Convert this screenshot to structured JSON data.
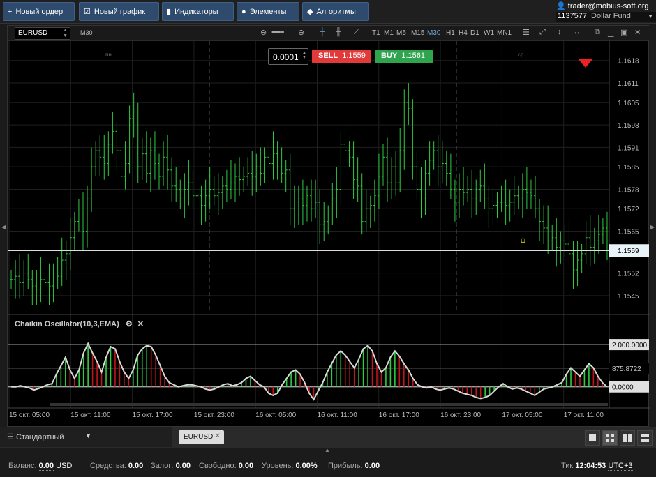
{
  "toolbar": {
    "new_order": "Новый ордер",
    "new_chart": "Новый график",
    "indicators": "Индикаторы",
    "elements": "Элементы",
    "algorithms": "Алгоритмы"
  },
  "account": {
    "user": "trader@mobius-soft.org",
    "id": "1137577",
    "fund": "Dollar Fund"
  },
  "chart": {
    "symbol": "EURUSD",
    "timeframe": "M30",
    "timeframes": [
      "T1",
      "M1",
      "M5",
      "M15",
      "M30",
      "H1",
      "H4",
      "D1",
      "W1",
      "MN1"
    ],
    "active_timeframe": "M30",
    "lot": "0.0001",
    "sell_label": "SELL",
    "sell_price": "1.1559",
    "buy_label": "BUY",
    "buy_price": "1.1561",
    "day_labels": [
      "пн",
      "ср"
    ],
    "current_price": "1.1559",
    "indicator_title": "Chaikin Oscillator(10,3,EMA)"
  },
  "chart_data": [
    {
      "type": "candlestick",
      "symbol": "EURUSD",
      "yticks": [
        "1.1618",
        "1.1611",
        "1.1605",
        "1.1598",
        "1.1591",
        "1.1585",
        "1.1578",
        "1.1572",
        "1.1565",
        "1.1559",
        "1.1552",
        "1.1545"
      ],
      "xticks": [
        "15 окт. 05:00",
        "15 окт. 11:00",
        "15 окт. 17:00",
        "15 окт. 23:00",
        "16 окт. 05:00",
        "16 окт. 11:00",
        "16 окт. 17:00",
        "16 окт. 23:00",
        "17 окт. 05:00",
        "17 окт. 11:00"
      ],
      "ylim": [
        1.154,
        1.1624
      ],
      "close": [
        1.155,
        1.1551,
        1.1549,
        1.1552,
        1.155,
        1.1548,
        1.1547,
        1.155,
        1.1549,
        1.1548,
        1.1552,
        1.1551,
        1.1556,
        1.1558,
        1.1563,
        1.1568,
        1.157,
        1.1565,
        1.1575,
        1.1585,
        1.159,
        1.1588,
        1.1586,
        1.1592,
        1.1596,
        1.159,
        1.1582,
        1.1586,
        1.16,
        1.1602,
        1.1585,
        1.1589,
        1.1583,
        1.159,
        1.1586,
        1.1582,
        1.1588,
        1.1584,
        1.1579,
        1.1578,
        1.1575,
        1.1578,
        1.158,
        1.1576,
        1.1576,
        1.1573,
        1.1576,
        1.1578,
        1.1576,
        1.1577,
        1.1579,
        1.1578,
        1.158,
        1.1582,
        1.1581,
        1.1582,
        1.1583,
        1.1582,
        1.1585,
        1.1583,
        1.1588,
        1.1586,
        1.1589,
        1.1585,
        1.1583,
        1.1584,
        1.1572,
        1.157,
        1.1575,
        1.1573,
        1.1576,
        1.1572,
        1.1574,
        1.1567,
        1.1568,
        1.157,
        1.1575,
        1.1578,
        1.1592,
        1.159,
        1.1588,
        1.1581,
        1.1579,
        1.1568,
        1.1572,
        1.1573,
        1.1576,
        1.1582,
        1.1588,
        1.158,
        1.1585,
        1.158,
        1.159,
        1.1605,
        1.1603,
        1.1585,
        1.1578,
        1.1575,
        1.1583,
        1.1587,
        1.159,
        1.1585,
        1.1586,
        1.1583,
        1.1578,
        1.1574,
        1.1578,
        1.1577,
        1.1578,
        1.1575,
        1.1578,
        1.1579,
        1.1575,
        1.1572,
        1.1573,
        1.1574,
        1.1574,
        1.1573,
        1.1574,
        1.1576,
        1.1575,
        1.1578,
        1.1577,
        1.1576,
        1.1572,
        1.1568,
        1.1566,
        1.1562,
        1.1563,
        1.156,
        1.1562,
        1.1561,
        1.1558,
        1.1553,
        1.1556,
        1.1558,
        1.1563,
        1.156,
        1.1562,
        1.1564,
        1.1566,
        1.1562
      ]
    },
    {
      "type": "area",
      "name": "Chaikin Oscillator(10,3,EMA)",
      "yticks": [
        "2 000.0000",
        "875.8722",
        "0.0000"
      ],
      "ylim": [
        -800,
        2300
      ],
      "values": [
        0,
        0,
        50,
        0,
        -50,
        -150,
        -80,
        0,
        100,
        150,
        600,
        1000,
        1400,
        800,
        400,
        800,
        1600,
        2050,
        1600,
        1200,
        700,
        1400,
        1900,
        1800,
        1200,
        700,
        400,
        800,
        1500,
        1800,
        1950,
        1900,
        1500,
        1000,
        500,
        200,
        100,
        0,
        50,
        100,
        100,
        50,
        0,
        -100,
        -150,
        -100,
        0,
        100,
        150,
        50,
        100,
        200,
        400,
        500,
        300,
        100,
        0,
        -300,
        -400,
        -300,
        100,
        400,
        700,
        800,
        600,
        200,
        -300,
        -600,
        -200,
        200,
        700,
        1100,
        1500,
        1700,
        1500,
        1200,
        900,
        1300,
        1800,
        1950,
        1700,
        1100,
        700,
        900,
        1400,
        1700,
        1450,
        1100,
        800,
        400,
        100,
        0,
        -50,
        0,
        -100,
        -150,
        -100,
        -50,
        -100,
        -200,
        -300,
        -350,
        -400,
        -500,
        -550,
        -500,
        -400,
        -200,
        0,
        150,
        0,
        -100,
        -50,
        -100,
        -200,
        -300,
        -400,
        -250,
        -100,
        -50,
        0,
        100,
        200,
        600,
        900,
        700,
        500,
        800,
        1100,
        900,
        500,
        200,
        0
      ]
    }
  ],
  "tabs": {
    "template": "Стандартный",
    "symbol_tab": "EURUSD"
  },
  "status": {
    "balance_label": "Баланс:",
    "balance": "0.00",
    "balance_ccy": "USD",
    "equity_label": "Средства:",
    "equity": "0.00",
    "margin_label": "Залог:",
    "margin": "0.00",
    "free_label": "Свободно:",
    "free": "0.00",
    "level_label": "Уровень:",
    "level": "0.00%",
    "profit_label": "Прибыль:",
    "profit": "0.00",
    "tick_label": "Тик",
    "tick_time": "12:04:53",
    "tz": "UTC+3"
  }
}
